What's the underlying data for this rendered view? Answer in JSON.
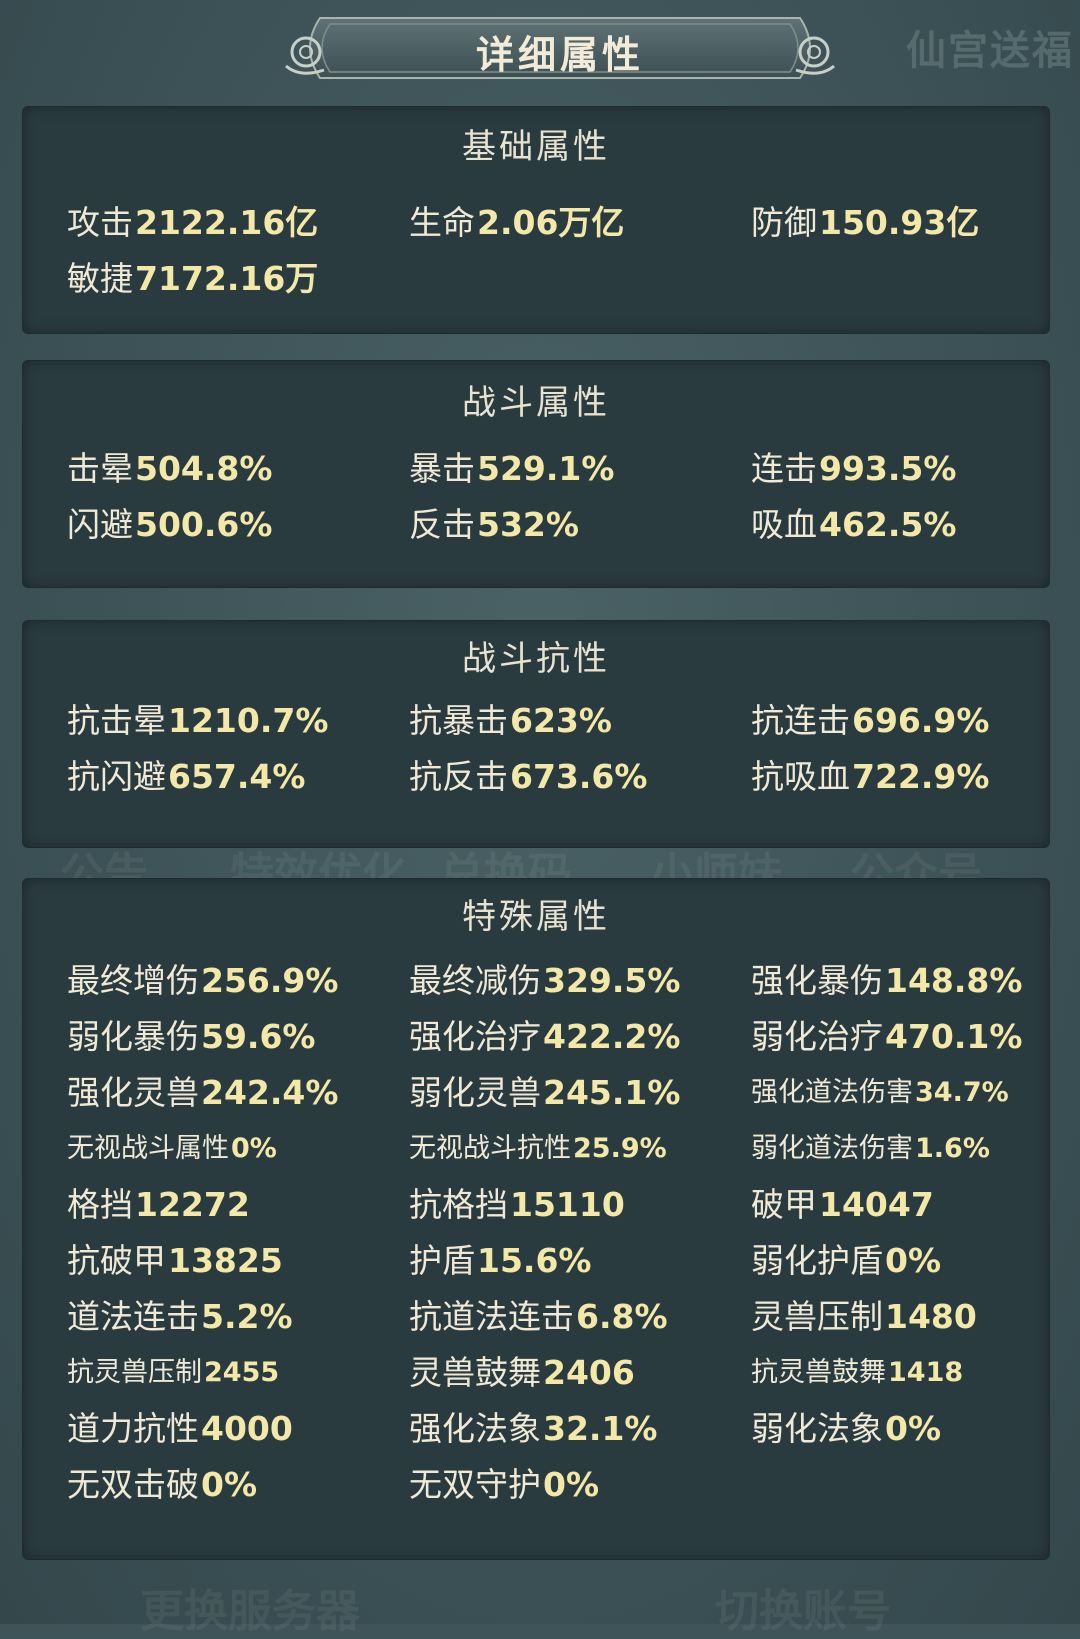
{
  "header": {
    "title": "详细属性",
    "watermark": "仙宫送福"
  },
  "sections": {
    "basic": {
      "title": "基础属性",
      "rows": [
        [
          {
            "label": "攻击",
            "value": "2122.16亿"
          },
          {
            "label": "生命",
            "value": "2.06万亿"
          },
          {
            "label": "防御",
            "value": "150.93亿"
          }
        ],
        [
          {
            "label": "敏捷",
            "value": "7172.16万"
          }
        ]
      ]
    },
    "combat": {
      "title": "战斗属性",
      "rows": [
        [
          {
            "label": "击晕",
            "value": "504.8%"
          },
          {
            "label": "暴击",
            "value": "529.1%"
          },
          {
            "label": "连击",
            "value": "993.5%"
          }
        ],
        [
          {
            "label": "闪避",
            "value": "500.6%"
          },
          {
            "label": "反击",
            "value": "532%"
          },
          {
            "label": "吸血",
            "value": "462.5%"
          }
        ]
      ]
    },
    "resist": {
      "title": "战斗抗性",
      "rows": [
        [
          {
            "label": "抗击晕",
            "value": "1210.7%"
          },
          {
            "label": "抗暴击",
            "value": "623%"
          },
          {
            "label": "抗连击",
            "value": "696.9%"
          }
        ],
        [
          {
            "label": "抗闪避",
            "value": "657.4%"
          },
          {
            "label": "抗反击",
            "value": "673.6%"
          },
          {
            "label": "抗吸血",
            "value": "722.9%"
          }
        ]
      ]
    },
    "special": {
      "title": "特殊属性",
      "rows": [
        [
          {
            "label": "最终增伤",
            "value": "256.9%"
          },
          {
            "label": "最终减伤",
            "value": "329.5%"
          },
          {
            "label": "强化暴伤",
            "value": "148.8%"
          }
        ],
        [
          {
            "label": "弱化暴伤",
            "value": "59.6%"
          },
          {
            "label": "强化治疗",
            "value": "422.2%"
          },
          {
            "label": "弱化治疗",
            "value": "470.1%"
          }
        ],
        [
          {
            "label": "强化灵兽",
            "value": "242.4%"
          },
          {
            "label": "弱化灵兽",
            "value": "245.1%"
          },
          {
            "label": "强化道法伤害",
            "value": "34.7%"
          }
        ],
        [
          {
            "label": "无视战斗属性",
            "value": "0%"
          },
          {
            "label": "无视战斗抗性",
            "value": "25.9%"
          },
          {
            "label": "弱化道法伤害",
            "value": "1.6%"
          }
        ],
        [
          {
            "label": "格挡",
            "value": "12272"
          },
          {
            "label": "抗格挡",
            "value": "15110"
          },
          {
            "label": "破甲",
            "value": "14047"
          }
        ],
        [
          {
            "label": "抗破甲",
            "value": "13825"
          },
          {
            "label": "护盾",
            "value": "15.6%"
          },
          {
            "label": "弱化护盾",
            "value": "0%"
          }
        ],
        [
          {
            "label": "道法连击",
            "value": "5.2%"
          },
          {
            "label": "抗道法连击",
            "value": "6.8%"
          },
          {
            "label": "灵兽压制",
            "value": "1480"
          }
        ],
        [
          {
            "label": "抗灵兽压制",
            "value": "2455"
          },
          {
            "label": "灵兽鼓舞",
            "value": "2406"
          },
          {
            "label": "抗灵兽鼓舞",
            "value": "1418"
          }
        ],
        [
          {
            "label": "道力抗性",
            "value": "4000"
          },
          {
            "label": "强化法象",
            "value": "32.1%"
          },
          {
            "label": "弱化法象",
            "value": "0%"
          }
        ],
        [
          {
            "label": "无双击破",
            "value": "0%"
          },
          {
            "label": "无双守护",
            "value": "0%"
          }
        ]
      ]
    }
  },
  "background_ghost_text": [
    "公告",
    "特效优化",
    "兑换码",
    "小师妹",
    "公众号",
    "更换服务器",
    "切换账号"
  ],
  "colors": {
    "background": "#3e5459",
    "panel": "#2a3b40",
    "label": "#efe9d6",
    "value": "#f4e8a8"
  }
}
